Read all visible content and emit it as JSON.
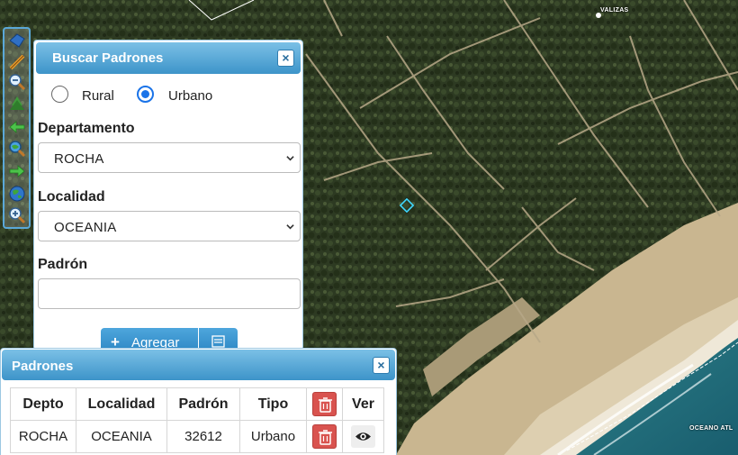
{
  "map": {
    "labels": {
      "valizas": "VALIZAS",
      "oceano": "OCEANO ATL"
    }
  },
  "search_panel": {
    "title": "Buscar Padrones",
    "close": "×",
    "radio_rural": "Rural",
    "radio_urbano": "Urbano",
    "selected_type": "Urbano",
    "departamento_label": "Departamento",
    "departamento_value": "ROCHA",
    "localidad_label": "Localidad",
    "localidad_value": "OCEANIA",
    "padron_label": "Padrón",
    "padron_value": "",
    "add_icon": "+",
    "add_label": "Agregar"
  },
  "results_panel": {
    "title": "Padrones",
    "close": "×",
    "columns": [
      "Depto",
      "Localidad",
      "Padrón",
      "Tipo"
    ],
    "last_column": "Ver",
    "rows": [
      {
        "depto": "ROCHA",
        "localidad": "OCEANIA",
        "padron": "32612",
        "tipo": "Urbano"
      }
    ]
  },
  "colors": {
    "header": "#3d94c9",
    "delete": "#d9534f",
    "parcel_outline": "#40d8ff"
  },
  "icons": [
    "pan-icon",
    "measure-icon",
    "zoom-out-icon",
    "pine-icon",
    "back-arrow-icon",
    "zoom-extent-icon",
    "forward-arrow-icon",
    "globe-icon",
    "zoom-in-icon",
    "close-icon",
    "plus-icon",
    "list-icon",
    "trash-icon",
    "eye-icon"
  ]
}
